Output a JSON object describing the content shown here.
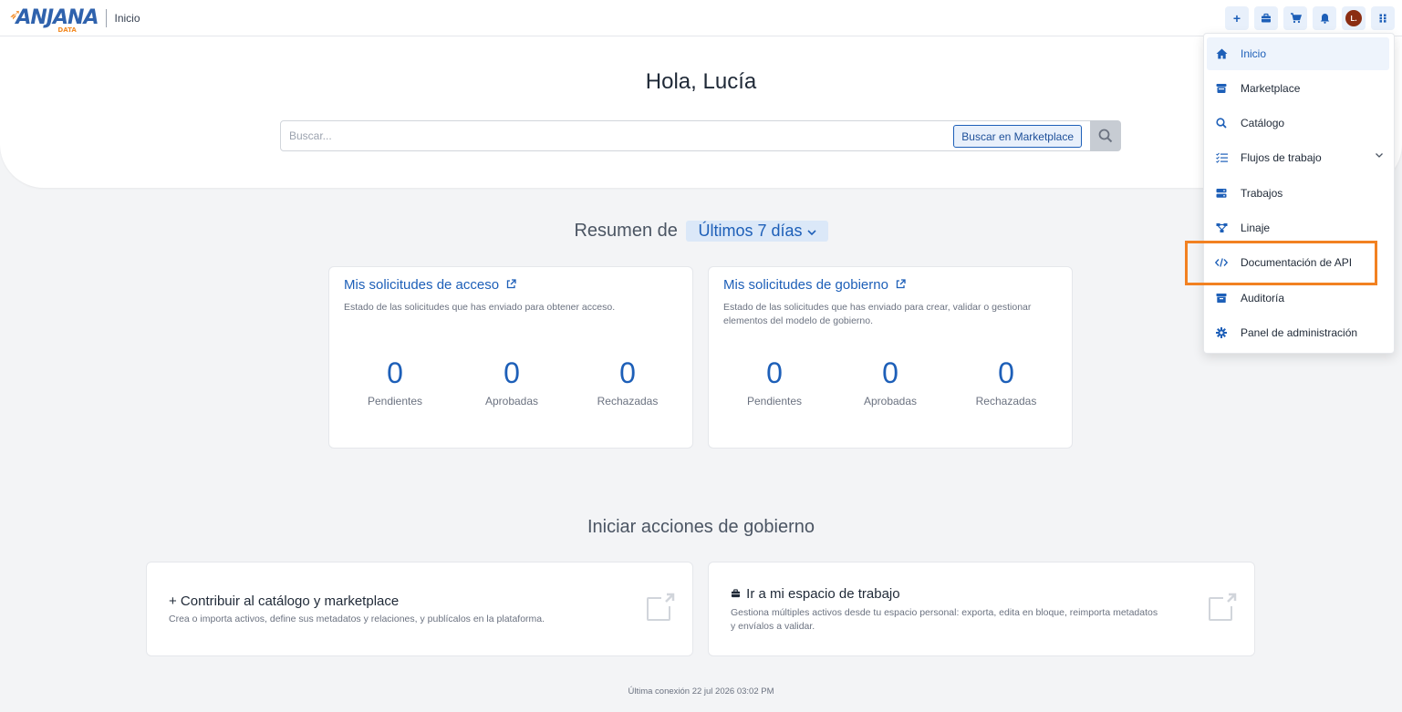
{
  "header": {
    "logo_text": "ANJANA",
    "logo_sub": "DATA",
    "breadcrumb": "Inicio",
    "avatar_initial": "L."
  },
  "hero": {
    "greeting": "Hola, Lucía",
    "search_placeholder": "Buscar...",
    "marketplace_button": "Buscar en Marketplace"
  },
  "summary": {
    "title": "Resumen de",
    "period": "Últimos 7 días"
  },
  "cards": [
    {
      "title": "Mis solicitudes de acceso",
      "description": "Estado de las solicitudes que has enviado para obtener acceso.",
      "stats": [
        {
          "value": "0",
          "label": "Pendientes"
        },
        {
          "value": "0",
          "label": "Aprobadas"
        },
        {
          "value": "0",
          "label": "Rechazadas"
        }
      ]
    },
    {
      "title": "Mis solicitudes de gobierno",
      "description": "Estado de las solicitudes que has enviado para crear, validar o gestionar elementos del modelo de gobierno.",
      "stats": [
        {
          "value": "0",
          "label": "Pendientes"
        },
        {
          "value": "0",
          "label": "Aprobadas"
        },
        {
          "value": "0",
          "label": "Rechazadas"
        }
      ]
    }
  ],
  "actions": {
    "title": "Iniciar acciones de gobierno",
    "items": [
      {
        "title": "+ Contribuir al catálogo y marketplace",
        "description": "Crea o importa activos, define sus metadatos y relaciones, y publícalos en la plataforma."
      },
      {
        "title": "Ir a mi espacio de trabajo",
        "description": "Gestiona múltiples activos desde tu espacio personal: exporta, edita en bloque, reimporta metadatos y envíalos a validar."
      }
    ]
  },
  "footer": {
    "last_login": "Última conexión 22 jul 2026 03:02 PM"
  },
  "menu": {
    "items": [
      {
        "label": "Inicio",
        "icon": "home-icon",
        "active": true
      },
      {
        "label": "Marketplace",
        "icon": "store-icon"
      },
      {
        "label": "Catálogo",
        "icon": "search-icon"
      },
      {
        "label": "Flujos de trabajo",
        "icon": "checklist-icon",
        "has_submenu": true
      },
      {
        "label": "Trabajos",
        "icon": "server-icon"
      },
      {
        "label": "Linaje",
        "icon": "lineage-icon"
      },
      {
        "label": "Documentación de API",
        "icon": "code-icon"
      },
      {
        "label": "Auditoría",
        "icon": "archive-icon"
      },
      {
        "label": "Panel de administración",
        "icon": "gear-icon"
      }
    ]
  },
  "colors": {
    "primary": "#1d5fb8",
    "accent": "#f28121",
    "avatar": "#8b2d12"
  }
}
